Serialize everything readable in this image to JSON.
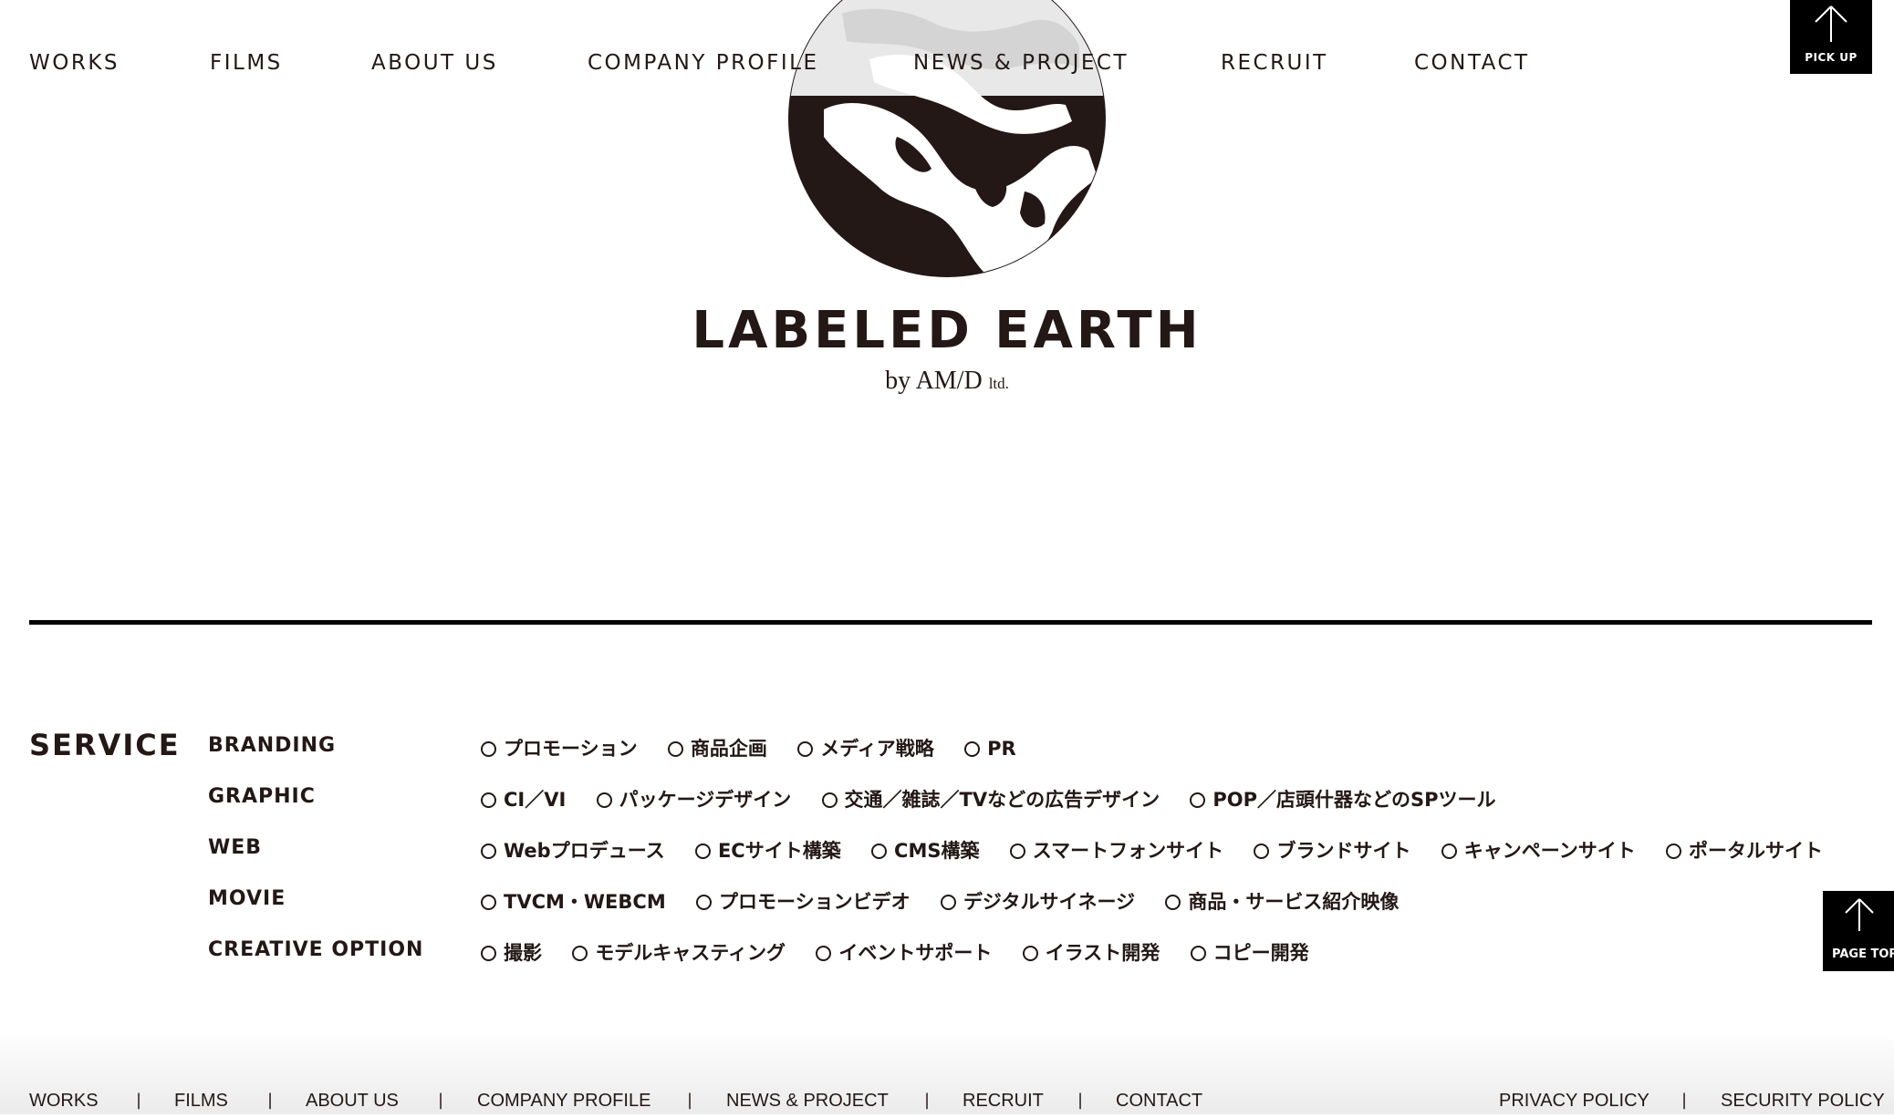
{
  "header": {
    "nav": [
      "WORKS",
      "FILMS",
      "ABOUT US",
      "COMPANY PROFILE",
      "NEWS & PROJECT",
      "RECRUIT",
      "CONTACT"
    ],
    "pickup_label": "PICK UP"
  },
  "hero": {
    "title": "LABELED EARTH",
    "subtitle_main": "by AM/D",
    "subtitle_small": "ltd."
  },
  "service": {
    "heading": "SERVICE",
    "rows": [
      {
        "category": "BRANDING",
        "items": [
          "プロモーション",
          "商品企画",
          "メディア戦略",
          "PR"
        ]
      },
      {
        "category": "GRAPHIC",
        "items": [
          "CI／VI",
          "パッケージデザイン",
          "交通／雑誌／TVなどの広告デザイン",
          "POP／店頭什器などのSPツール"
        ]
      },
      {
        "category": "WEB",
        "items": [
          "Webプロデュース",
          "ECサイト構築",
          "CMS構築",
          "スマートフォンサイト",
          "ブランドサイト",
          "キャンペーンサイト",
          "ポータルサイト"
        ]
      },
      {
        "category": "MOVIE",
        "items": [
          "TVCM・WEBCM",
          "プロモーションビデオ",
          "デジタルサイネージ",
          "商品・サービス紹介映像"
        ]
      },
      {
        "category": "CREATIVE OPTION",
        "items": [
          "撮影",
          "モデルキャスティング",
          "イベントサポート",
          "イラスト開発",
          "コピー開発"
        ]
      }
    ],
    "page_top_label": "PAGE TOP"
  },
  "footer": {
    "nav": [
      "WORKS",
      "FILMS",
      "ABOUT US",
      "COMPANY PROFILE",
      "NEWS & PROJECT",
      "RECRUIT",
      "CONTACT"
    ],
    "legal": [
      "PRIVACY POLICY",
      "SECURITY POLICY"
    ],
    "separator": "|"
  }
}
